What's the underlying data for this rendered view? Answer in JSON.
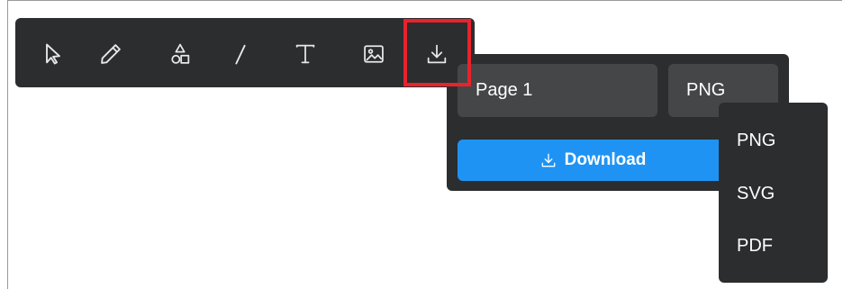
{
  "colors": {
    "toolbar_bg": "#2c2d2f",
    "field_bg": "#454648",
    "accent": "#1f93f3",
    "highlight": "#e8232c"
  },
  "toolbar": {
    "tools": [
      {
        "name": "select-tool",
        "icon": "cursor-arrow-icon"
      },
      {
        "name": "pencil-tool",
        "icon": "pencil-icon"
      },
      {
        "name": "shapes-tool",
        "icon": "shapes-icon"
      },
      {
        "name": "line-tool",
        "icon": "line-icon"
      },
      {
        "name": "text-tool",
        "icon": "text-icon"
      },
      {
        "name": "image-tool",
        "icon": "image-icon"
      },
      {
        "name": "export-tool",
        "icon": "download-icon",
        "active": true
      }
    ]
  },
  "export_panel": {
    "page_value": "Page 1",
    "format_value": "PNG",
    "download_label": "Download"
  },
  "format_menu": {
    "options": [
      "PNG",
      "SVG",
      "PDF"
    ]
  }
}
